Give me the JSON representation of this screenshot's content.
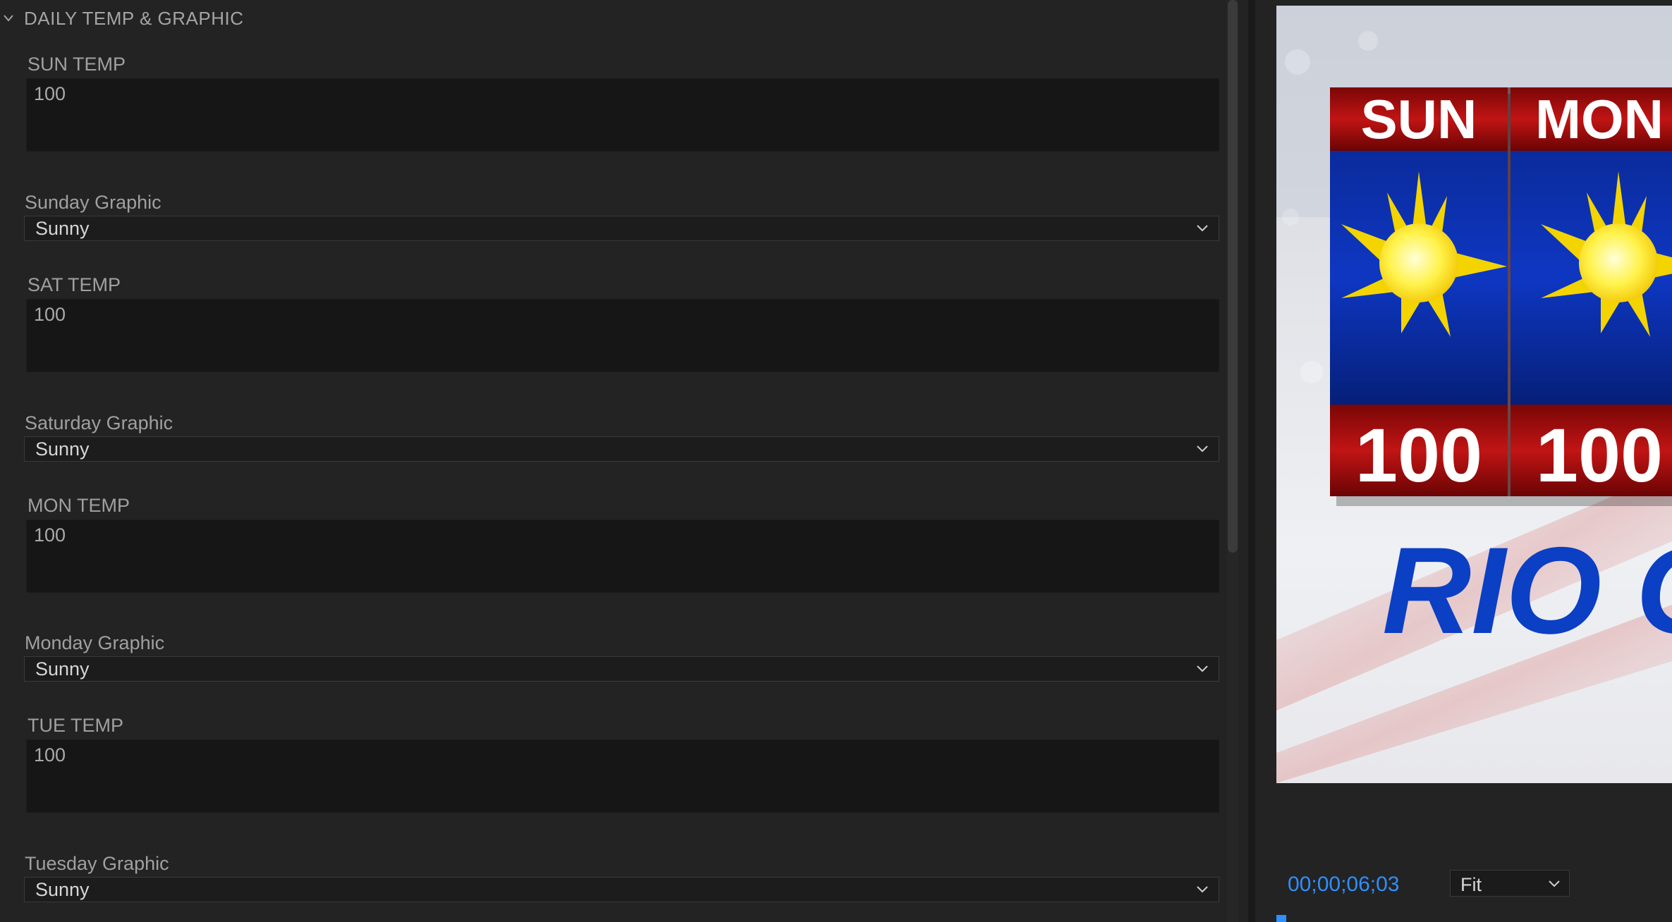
{
  "section": {
    "title": "DAILY TEMP & GRAPHIC"
  },
  "fields": [
    {
      "temp_label": "SUN TEMP",
      "temp_value": "100",
      "graphic_label": "Sunday Graphic",
      "graphic_value": "Sunny"
    },
    {
      "temp_label": "SAT TEMP",
      "temp_value": "100",
      "graphic_label": "Saturday Graphic",
      "graphic_value": "Sunny"
    },
    {
      "temp_label": "MON TEMP",
      "temp_value": "100",
      "graphic_label": "Monday Graphic",
      "graphic_value": "Sunny"
    },
    {
      "temp_label": "TUE TEMP",
      "temp_value": "100",
      "graphic_label": "Tuesday Graphic",
      "graphic_value": "Sunny"
    }
  ],
  "preview": {
    "days": [
      {
        "day": "SUN",
        "temp": "100",
        "icon": "sun-icon"
      },
      {
        "day": "MON",
        "temp": "100",
        "icon": "sun-icon"
      }
    ],
    "caption": "RIO G",
    "colors": {
      "red_header": "#b01010",
      "blue_panel": "#0a2fa8",
      "caption_blue": "#0b3fc4"
    }
  },
  "monitor": {
    "timecode": "00;00;06;03",
    "zoom": "Fit"
  },
  "colors": {
    "accent": "#2e8fff",
    "panel_bg": "#232323",
    "field_bg": "#161616"
  }
}
